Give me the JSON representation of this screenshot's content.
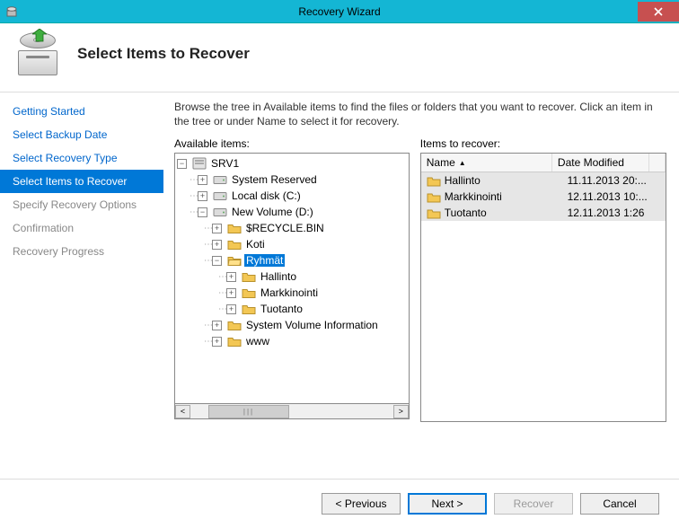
{
  "window": {
    "title": "Recovery Wizard"
  },
  "header": {
    "title": "Select Items to Recover"
  },
  "steps": [
    {
      "label": "Getting Started",
      "state": "done"
    },
    {
      "label": "Select Backup Date",
      "state": "done"
    },
    {
      "label": "Select Recovery Type",
      "state": "done"
    },
    {
      "label": "Select Items to Recover",
      "state": "current"
    },
    {
      "label": "Specify Recovery Options",
      "state": "future"
    },
    {
      "label": "Confirmation",
      "state": "future"
    },
    {
      "label": "Recovery Progress",
      "state": "future"
    }
  ],
  "instructions": "Browse the tree in Available items to find the files or folders that you want to recover. Click an item in the tree or under Name to select it for recovery.",
  "labels": {
    "available": "Available items:",
    "recover": "Items to recover:",
    "name_col": "Name",
    "date_col": "Date Modified"
  },
  "tree": {
    "srv": "SRV1",
    "sysres": "System Reserved",
    "localc": "Local disk (C:)",
    "newvol": "New Volume (D:)",
    "recycle": "$RECYCLE.BIN",
    "koti": "Koti",
    "ryhmat": "Ryhmät",
    "hallinto": "Hallinto",
    "markkinointi": "Markkinointi",
    "tuotanto": "Tuotanto",
    "svi": "System Volume Information",
    "www": "www"
  },
  "items": [
    {
      "name": "Hallinto",
      "date": "11.11.2013 20:..."
    },
    {
      "name": "Markkinointi",
      "date": "12.11.2013 10:..."
    },
    {
      "name": "Tuotanto",
      "date": "12.11.2013 1:26"
    }
  ],
  "buttons": {
    "previous": "< Previous",
    "next": "Next >",
    "recover": "Recover",
    "cancel": "Cancel"
  }
}
